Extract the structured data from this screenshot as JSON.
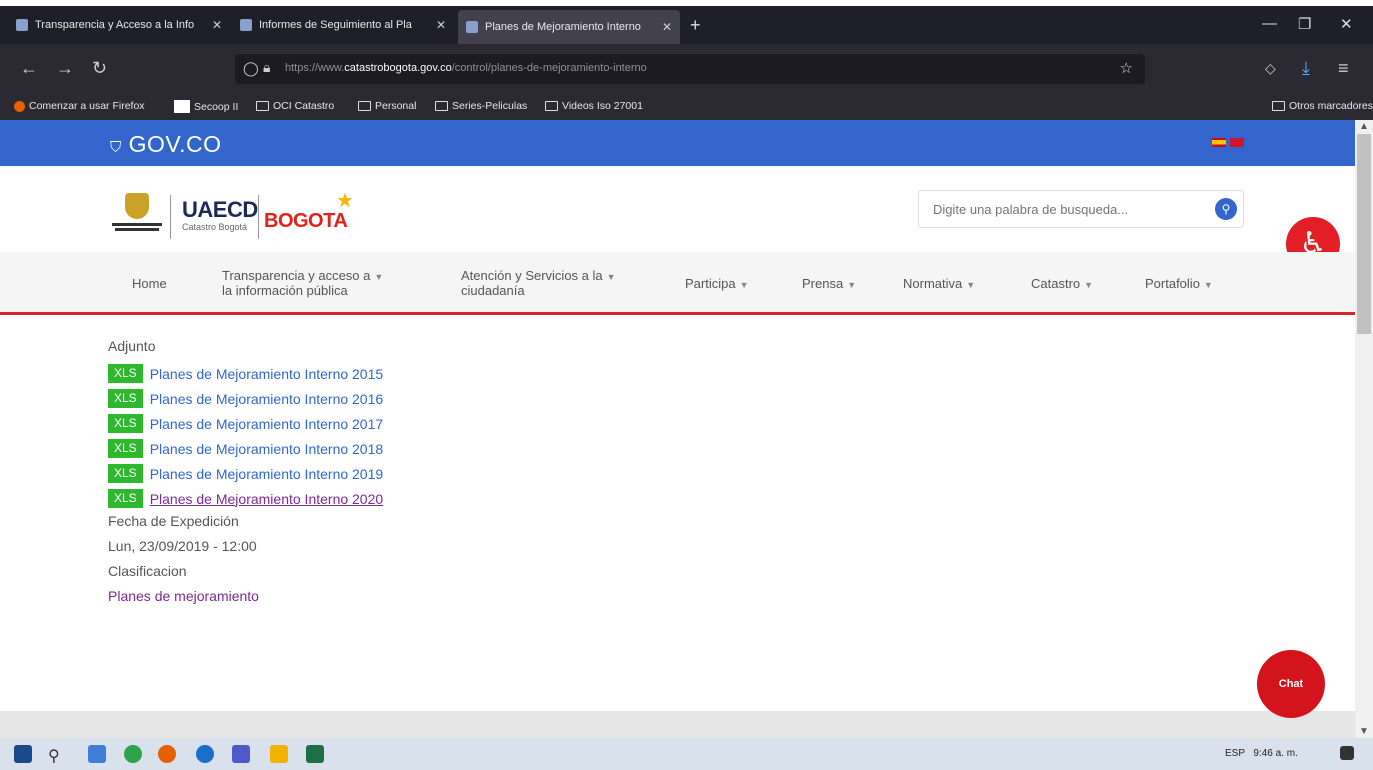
{
  "browser": {
    "tabs": [
      {
        "label": "Transparencia y Acceso a la Info",
        "active": false
      },
      {
        "label": "Informes de Seguimiento al Pla",
        "active": false
      },
      {
        "label": "Planes de Mejoramiento Interno",
        "active": true
      }
    ],
    "new_tab_glyph": "+",
    "url_prefix": "https://www.",
    "url_domain": "catastrobogota.gov.co",
    "url_path": "/control/planes-de-mejoramiento-interno",
    "bookmarks": [
      "Comenzar a usar Firefox",
      "Secoop II",
      "OCI Catastro",
      "Personal",
      "Series-Peliculas",
      "Videos Iso 27001"
    ],
    "other_bookmarks": "Otros marcadores"
  },
  "govbar": {
    "logo": "GOV.CO"
  },
  "header": {
    "uaecd": "UAECD",
    "uaecd_sub": "Catastro Bogotá",
    "bogota": "BOGOTA",
    "search_placeholder": "Digite una palabra de busqueda..."
  },
  "menu": {
    "items": [
      {
        "line1": "Home",
        "line2": "",
        "has_caret": false
      },
      {
        "line1": "Transparencia y acceso a",
        "line2": "la información pública",
        "has_caret": true
      },
      {
        "line1": "Atención y Servicios a la",
        "line2": "ciudadanía",
        "has_caret": true
      },
      {
        "line1": "Participa",
        "line2": "",
        "has_caret": true
      },
      {
        "line1": "Prensa",
        "line2": "",
        "has_caret": true
      },
      {
        "line1": "Normativa",
        "line2": "",
        "has_caret": true
      },
      {
        "line1": "Catastro",
        "line2": "",
        "has_caret": true
      },
      {
        "line1": "Portafolio",
        "line2": "",
        "has_caret": true
      }
    ]
  },
  "content": {
    "attachment_label": "Adjunto",
    "file_badge": "XLS",
    "attachments": [
      "Planes de Mejoramiento Interno 2015",
      "Planes de Mejoramiento Interno 2016",
      "Planes de Mejoramiento Interno 2017",
      "Planes de Mejoramiento Interno 2018",
      "Planes de Mejoramiento Interno 2019",
      "Planes de Mejoramiento Interno 2020"
    ],
    "issue_date_label": "Fecha de Expedición",
    "issue_date": "Lun, 23/09/2019 - 12:00",
    "classification_label": "Clasificacion",
    "classification": "Planes de mejoramiento"
  },
  "chat": {
    "label": "Chat"
  },
  "taskbar": {
    "language": "ESP",
    "time": "9:46 a. m."
  },
  "colors": {
    "gov_blue": "#3366cc",
    "accent_red": "#d8232a",
    "xls_green": "#2eb82e",
    "visited_link": "#7a2a96"
  }
}
